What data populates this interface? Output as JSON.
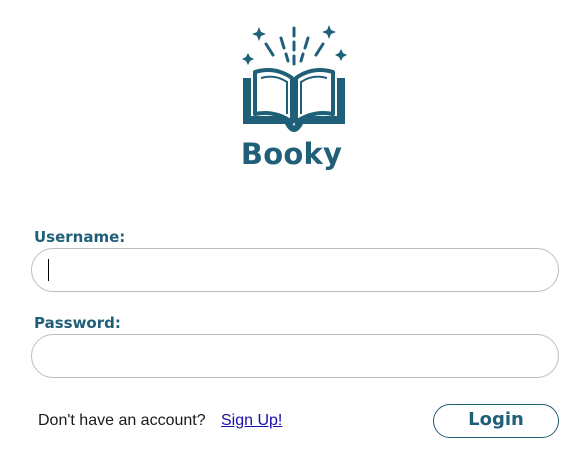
{
  "app": {
    "title": "Booky",
    "logo_icon": "open-book-sparkle-icon",
    "brand_color": "#1f5f78"
  },
  "form": {
    "username_label": "Username:",
    "username_value": "",
    "password_label": "Password:",
    "password_value": ""
  },
  "footer": {
    "signup_prompt": "Don't have an account?",
    "signup_link": "Sign Up!",
    "login_label": "Login"
  },
  "colors": {
    "link": "#1a0dab",
    "input_border": "#b9bfc4"
  }
}
